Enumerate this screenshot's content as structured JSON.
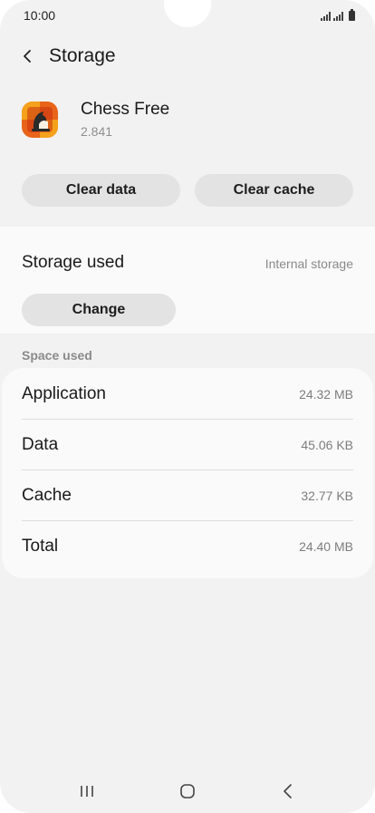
{
  "status_bar": {
    "time": "10:00"
  },
  "header": {
    "title": "Storage"
  },
  "app": {
    "name": "Chess Free",
    "version": "2.841"
  },
  "actions": {
    "clear_data": "Clear data",
    "clear_cache": "Clear cache"
  },
  "storage_used": {
    "label": "Storage used",
    "value": "Internal storage",
    "change_button": "Change"
  },
  "space_used": {
    "header": "Space used",
    "rows": [
      {
        "label": "Application",
        "value": "24.32 MB"
      },
      {
        "label": "Data",
        "value": "45.06 KB"
      },
      {
        "label": "Cache",
        "value": "32.77 KB"
      },
      {
        "label": "Total",
        "value": "24.40 MB"
      }
    ]
  },
  "icons": {
    "back": "chevron-left-icon",
    "app": "chess-app-icon",
    "nav_recents": "recents-icon",
    "nav_home": "home-icon",
    "nav_back": "nav-back-icon"
  },
  "colors": {
    "background": "#f2f2f2",
    "card": "#fafafa",
    "pill": "#e3e3e3",
    "secondary_text": "#8a8a8a"
  }
}
